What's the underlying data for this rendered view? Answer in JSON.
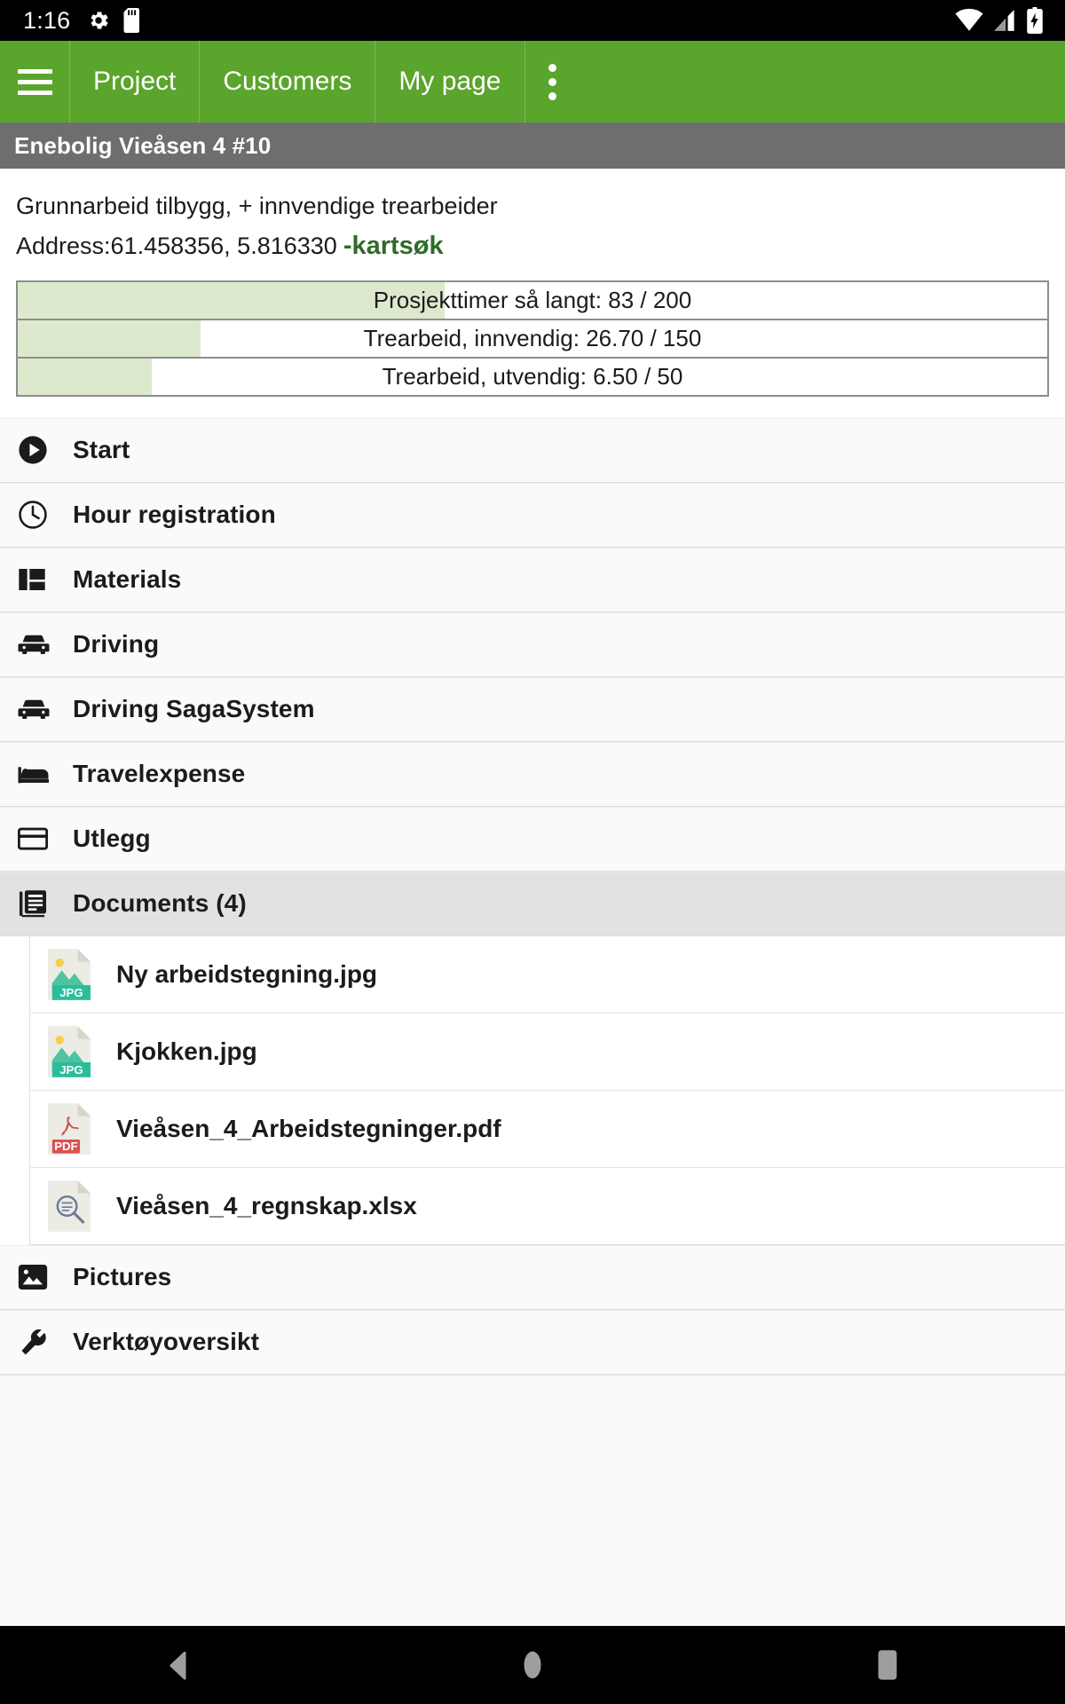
{
  "status_bar": {
    "time": "1:16",
    "left_icons": [
      "settings-gear-icon",
      "sd-card-icon"
    ],
    "right_icons": [
      "wifi-icon",
      "cellular-signal-icon",
      "battery-charging-icon"
    ]
  },
  "app_bar": {
    "menu_icon": "hamburger-menu-icon",
    "tabs": [
      {
        "label": "Project"
      },
      {
        "label": "Customers"
      },
      {
        "label": "My page"
      }
    ],
    "overflow_icon": "more-vertical-icon",
    "background": "#5aa52b"
  },
  "project_bar": {
    "title": "Enebolig Vieåsen 4 #10",
    "background": "#6e6e6e"
  },
  "project_info": {
    "description": "Grunnarbeid tilbygg, + innvendige trearbeider",
    "address_label": "Address:61.458356, 5.816330",
    "map_link": "-kartsøk",
    "map_link_color": "#2f6b2a"
  },
  "chart_data": {
    "type": "bar",
    "title": "Project hour progress bars",
    "orientation": "horizontal",
    "fill_color": "#dde9cd",
    "track_color": "#ffffff",
    "border_color": "#8d8d8d",
    "categories": [
      "Prosjekttimer så langt",
      "Trearbeid, innvendig",
      "Trearbeid, utvendig"
    ],
    "values": [
      83,
      26.7,
      6.5
    ],
    "maximums": [
      200,
      150,
      50
    ],
    "percents": [
      41.5,
      17.8,
      13.0
    ],
    "labels": [
      "Prosjekttimer så langt: 83 / 200",
      "Trearbeid, innvendig: 26.70 / 150",
      "Trearbeid, utvendig: 6.50 / 50"
    ],
    "xlabel": "",
    "ylabel": "",
    "xlim": [
      0,
      100
    ],
    "grid": false,
    "legend": "none"
  },
  "menu": {
    "items": [
      {
        "label": "Start",
        "icon": "play-circle-icon",
        "selected": false
      },
      {
        "label": "Hour registration",
        "icon": "clock-icon",
        "selected": false
      },
      {
        "label": "Materials",
        "icon": "dashboard-blocks-icon",
        "selected": false
      },
      {
        "label": "Driving",
        "icon": "car-icon",
        "selected": false
      },
      {
        "label": "Driving SagaSystem",
        "icon": "car-icon",
        "selected": false
      },
      {
        "label": "Travelexpense",
        "icon": "bed-icon",
        "selected": false
      },
      {
        "label": "Utlegg",
        "icon": "credit-card-icon",
        "selected": false
      },
      {
        "label": "Documents (4)",
        "icon": "documents-icon",
        "selected": true
      }
    ],
    "tail_items": [
      {
        "label": "Pictures",
        "icon": "picture-icon"
      },
      {
        "label": "Verktøyoversikt",
        "icon": "wrench-icon"
      }
    ]
  },
  "documents": {
    "count": 4,
    "files": [
      {
        "name": "Ny arbeidstegning.jpg",
        "icon": "jpg-file-icon",
        "badge": "JPG",
        "badge_color": "#2bbd9a"
      },
      {
        "name": "Kjokken.jpg",
        "icon": "jpg-file-icon",
        "badge": "JPG",
        "badge_color": "#2bbd9a"
      },
      {
        "name": "Vieåsen_4_Arbeidstegninger.pdf",
        "icon": "pdf-file-icon",
        "badge": "PDF",
        "badge_color": "#d9534f"
      },
      {
        "name": "Vieåsen_4_regnskap.xlsx",
        "icon": "generic-file-icon",
        "badge": "",
        "badge_color": "#6b7a99"
      }
    ]
  },
  "nav_bar": {
    "buttons": [
      {
        "icon": "back-triangle-icon"
      },
      {
        "icon": "home-circle-icon"
      },
      {
        "icon": "recents-square-icon"
      }
    ]
  }
}
